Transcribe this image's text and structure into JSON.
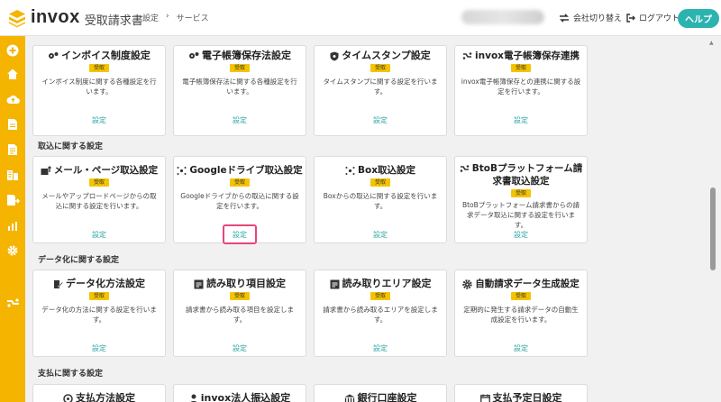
{
  "header": {
    "logo_text": "invox",
    "logo_sub": "受取請求書",
    "breadcrumb": [
      "設定",
      "›",
      "サービス"
    ],
    "company_switch": "会社切り替え",
    "logout": "ログアウト",
    "help": "ヘルプ"
  },
  "colors": {
    "accent": "#f5b400",
    "teal": "#2bb3b0",
    "highlight": "#e8457d"
  },
  "sidebar": {
    "icons": [
      "plus-circle-icon",
      "home-icon",
      "cloud-upload-icon",
      "document-icon",
      "document-list-icon",
      "building-icon",
      "document-send-icon",
      "chart-icon",
      "gear-icon",
      "link-icon"
    ]
  },
  "badge_label": "受取",
  "link_label": "設定",
  "row1": [
    {
      "title": "インボイス制度設定",
      "desc": "インボイス制度に関する各種設定を行います。"
    },
    {
      "title": "電子帳簿保存法設定",
      "desc": "電子帳簿保存法に関する各種設定を行います。"
    },
    {
      "title": "タイムスタンプ設定",
      "desc": "タイムスタンプに関する設定を行います。"
    },
    {
      "title": "invox電子帳簿保存連携",
      "desc": "invox電子帳簿保存との連携に関する設定を行います。"
    }
  ],
  "section_import": "取込に関する設定",
  "row2": [
    {
      "title": "メール・ページ取込設定",
      "desc": "メールやアップロードページからの取込に関する設定を行います。"
    },
    {
      "title": "Googleドライブ取込設定",
      "desc": "Googleドライブからの取込に関する設定を行います。"
    },
    {
      "title": "Box取込設定",
      "desc": "Boxからの取込に関する設定を行います。"
    },
    {
      "title": "BtoBプラットフォーム請求書取込設定",
      "title_line1": "BtoBプラットフォーム請",
      "title_line2": "求書取込設定",
      "desc": "BtoBプラットフォーム請求書からの請求データ取込に関する設定を行います。"
    }
  ],
  "section_data": "データ化に関する設定",
  "row3": [
    {
      "title": "データ化方法設定",
      "desc": "データ化の方法に関する設定を行います。"
    },
    {
      "title": "読み取り項目設定",
      "desc": "請求書から読み取る項目を設定します。"
    },
    {
      "title": "読み取りエリア設定",
      "desc": "請求書から読み取るエリアを設定します。"
    },
    {
      "title": "自動請求データ生成設定",
      "desc": "定期的に発生する請求データの自動生成設定を行います。"
    }
  ],
  "section_payment": "支払に関する設定",
  "row4": [
    {
      "title": "支払方法設定"
    },
    {
      "title": "invox法人振込設定"
    },
    {
      "title": "銀行口座設定"
    },
    {
      "title": "支払予定日設定"
    }
  ]
}
